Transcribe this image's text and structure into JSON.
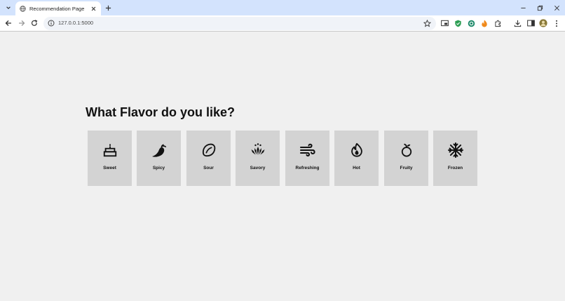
{
  "browser": {
    "tab_title": "Recommendation Page",
    "url": "127.0.0.1:5000"
  },
  "page": {
    "title": "What Flavor do you like?",
    "flavors": [
      {
        "label": "Sweet",
        "icon": "cake-icon"
      },
      {
        "label": "Spicy",
        "icon": "chili-pepper-icon"
      },
      {
        "label": "Sour",
        "icon": "lemon-icon"
      },
      {
        "label": "Savory",
        "icon": "savory-icon"
      },
      {
        "label": "Refreshing",
        "icon": "wind-icon"
      },
      {
        "label": "Hot",
        "icon": "flame-icon"
      },
      {
        "label": "Fruity",
        "icon": "fruit-icon"
      },
      {
        "label": "Frozen",
        "icon": "snowflake-icon"
      }
    ]
  },
  "colors": {
    "tabstrip": "#d3e3fd",
    "page_background": "#f0f0f0",
    "card_background": "#d3d3d3",
    "text": "#111111"
  }
}
